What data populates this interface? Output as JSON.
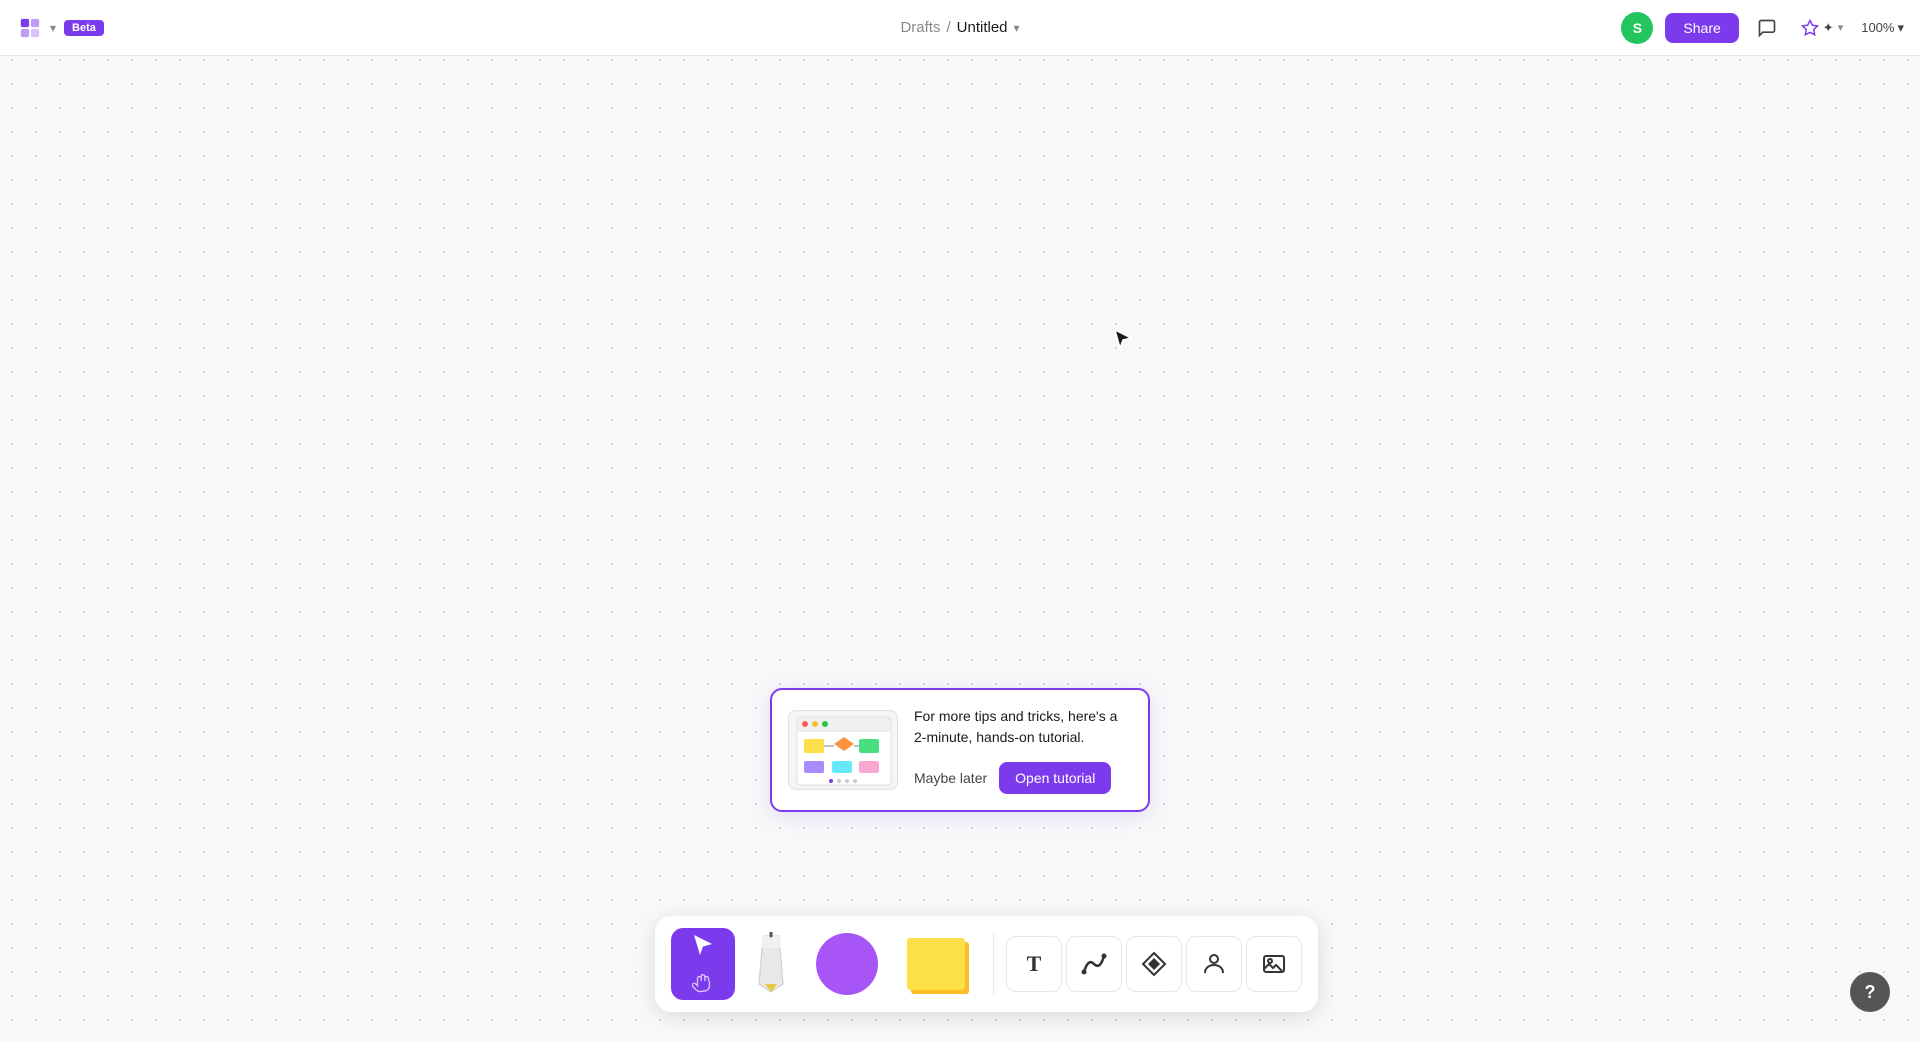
{
  "header": {
    "logo_chevron": "▾",
    "beta_label": "Beta",
    "breadcrumb_drafts": "Drafts",
    "breadcrumb_sep": "/",
    "breadcrumb_title": "Untitled",
    "breadcrumb_chevron": "▾",
    "avatar_letter": "S",
    "share_label": "Share",
    "zoom_label": "100%",
    "zoom_chevron": "▾"
  },
  "tutorial": {
    "text": "For more tips and tricks, here's a 2-minute, hands-on tutorial.",
    "maybe_later_label": "Maybe later",
    "open_tutorial_label": "Open tutorial"
  },
  "toolbar": {
    "text_icon": "T",
    "path_icon": "~",
    "diamond_icon": "◈",
    "person_icon": "👤",
    "image_icon": "🖼"
  },
  "help": {
    "label": "?"
  }
}
